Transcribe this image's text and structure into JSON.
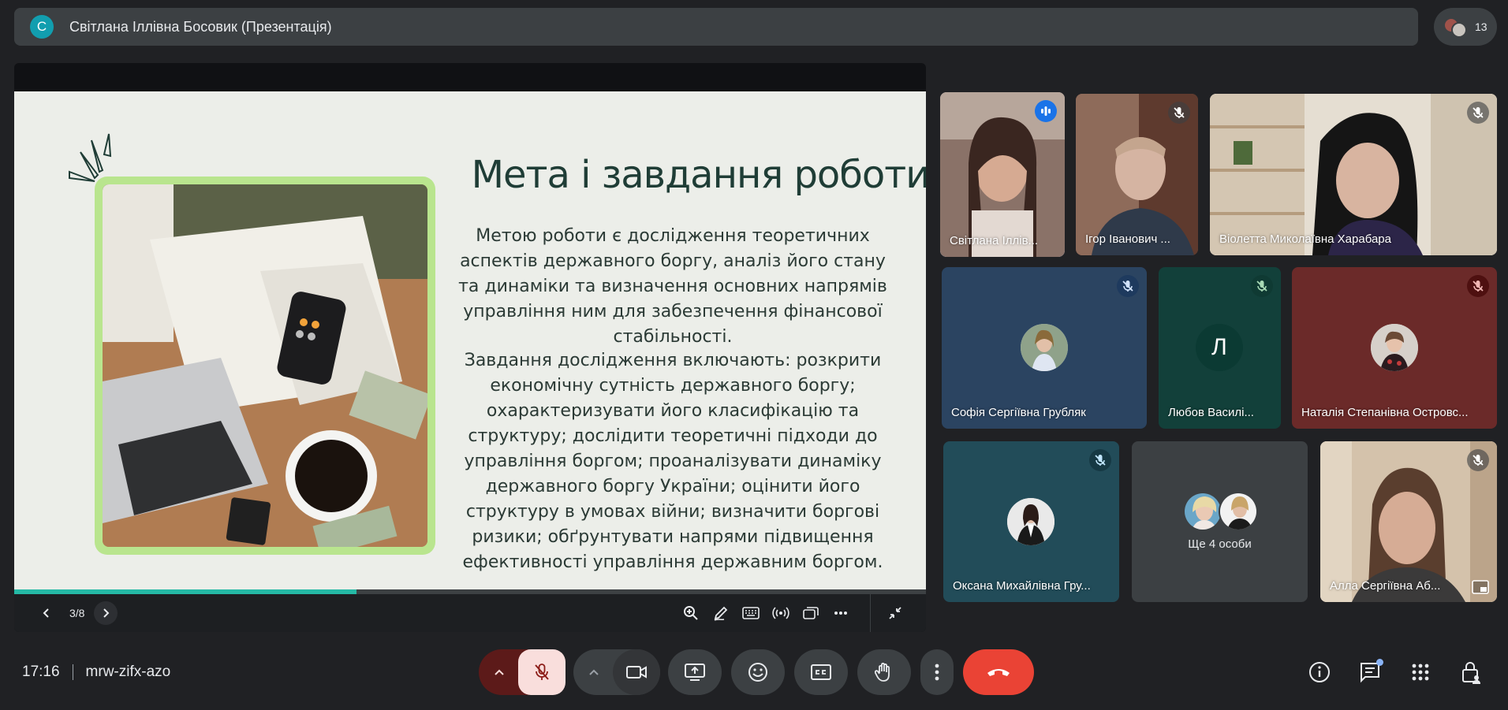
{
  "topbar": {
    "presenter_initial": "С",
    "presenter_title": "Світлана Іллівна Босовик (Презентація)",
    "participant_count": "13",
    "avatar_color": "#129eaf"
  },
  "slide": {
    "title": "Мета і завдання роботи",
    "paragraph1": "Метою роботи є дослідження  теоретичних аспектів державного боргу, аналіз його стану та динаміки та визначення основних напрямів управління ним для забезпечення фінансової стабільності.",
    "paragraph2": "Завдання дослідження включають: розкрити економічну сутність державного боргу; охарактеризувати його класифікацію та структуру; дослідити теоретичні підходи до управління боргом; проаналізувати динаміку державного боргу України; оцінити його структуру в умовах війни; визначити боргові ризики; обґрунтувати напрями підвищення ефективності управління державним боргом.",
    "page": "3/8",
    "progress_fraction": 0.375,
    "frame_color": "#b9e58e",
    "title_color": "#1f3d36"
  },
  "participants": [
    {
      "name": "Світлана Іллів...",
      "status": "speaking"
    },
    {
      "name": "Ігор Іванович ...",
      "status": "muted"
    },
    {
      "name": "Віолетта Миколаївна Харабара",
      "status": "muted"
    },
    {
      "name": "Софія Сергіївна Грубляк",
      "status": "muted"
    },
    {
      "name": "Любов Василі...",
      "status": "muted",
      "initial": "Л"
    },
    {
      "name": "Наталія Степанівна Островс...",
      "status": "muted"
    },
    {
      "name": "Оксана Михайлівна Гру...",
      "status": "muted"
    },
    {
      "name": "Ще 4 особи",
      "status": "group"
    },
    {
      "name": "Алла Сергіївна Аб...",
      "status": "muted"
    }
  ],
  "meeting": {
    "time": "17:16",
    "code": "mrw-zifx-azo"
  },
  "colors": {
    "end_call": "#ea4335",
    "mic_muted_bg": "#f9dedc",
    "mic_muted_dark": "#8c1d18",
    "accent": "#25b9a5"
  }
}
